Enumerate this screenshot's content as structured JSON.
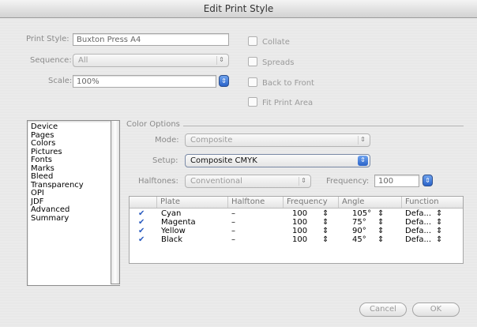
{
  "window": {
    "title": "Edit Print Style"
  },
  "top": {
    "print_style_label": "Print Style:",
    "print_style_value": "Buxton Press A4",
    "sequence_label": "Sequence:",
    "sequence_value": "All",
    "scale_label": "Scale:",
    "scale_value": "100%"
  },
  "checkboxes": {
    "collate": "Collate",
    "spreads": "Spreads",
    "back_to_front": "Back to Front",
    "fit_print_area": "Fit Print Area"
  },
  "sidebar": {
    "items": [
      "Device",
      "Pages",
      "Colors",
      "Pictures",
      "Fonts",
      "Marks",
      "Bleed",
      "Transparency",
      "OPI",
      "JDF",
      "Advanced",
      "Summary"
    ]
  },
  "color_options": {
    "group_title": "Color Options",
    "mode_label": "Mode:",
    "mode_value": "Composite",
    "setup_label": "Setup:",
    "setup_value": "Composite CMYK",
    "halftones_label": "Halftones:",
    "halftones_value": "Conventional",
    "frequency_label": "Frequency:",
    "frequency_value": "100"
  },
  "table": {
    "headers": [
      "Plate",
      "Halftone",
      "Frequency",
      "Angle",
      "Function"
    ],
    "rows": [
      {
        "plate": "Cyan",
        "halftone": "–",
        "frequency": "100",
        "angle": "105°",
        "function": "Defa..."
      },
      {
        "plate": "Magenta",
        "halftone": "–",
        "frequency": "100",
        "angle": "75°",
        "function": "Defa..."
      },
      {
        "plate": "Yellow",
        "halftone": "–",
        "frequency": "100",
        "angle": "90°",
        "function": "Defa..."
      },
      {
        "plate": "Black",
        "halftone": "–",
        "frequency": "100",
        "angle": "45°",
        "function": "Defa..."
      }
    ]
  },
  "buttons": {
    "cancel": "Cancel",
    "ok": "OK"
  },
  "icons": {
    "checkmark": "checkmark-icon",
    "updown": "updown-arrows-icon"
  },
  "colors": {
    "accent": "#2a63c9",
    "check": "#2a5bbf"
  }
}
